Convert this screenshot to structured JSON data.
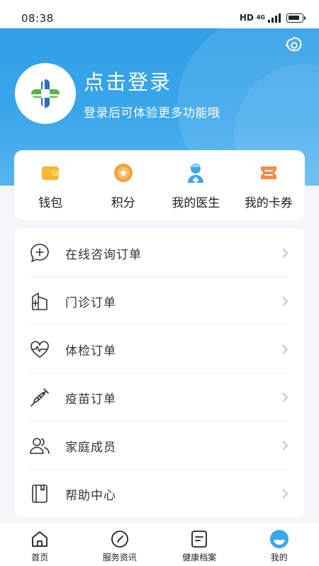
{
  "status_bar": {
    "time": "08:38",
    "hd": "HD",
    "network": "4G"
  },
  "profile": {
    "title": "点击登录",
    "subtitle": "登录后可体验更多功能哦"
  },
  "quick_actions": [
    {
      "label": "钱包",
      "icon": "wallet-icon",
      "color": "#f5b731"
    },
    {
      "label": "积分",
      "icon": "points-star-icon",
      "color": "#f2a03d"
    },
    {
      "label": "我的医生",
      "icon": "doctor-icon",
      "color": "#3ba7ea"
    },
    {
      "label": "我的卡券",
      "icon": "coupon-icon",
      "color": "#f48a4d"
    }
  ],
  "menu": [
    {
      "label": "在线咨询订单",
      "icon": "chat-plus-icon"
    },
    {
      "label": "门诊订单",
      "icon": "hospital-icon"
    },
    {
      "label": "体检订单",
      "icon": "heart-pulse-icon"
    },
    {
      "label": "疫苗订单",
      "icon": "syringe-icon"
    },
    {
      "label": "家庭成员",
      "icon": "family-members-icon"
    },
    {
      "label": "帮助中心",
      "icon": "help-book-icon"
    }
  ],
  "tabbar": [
    {
      "label": "首页",
      "icon": "home-icon"
    },
    {
      "label": "服务资讯",
      "icon": "compass-icon"
    },
    {
      "label": "健康档案",
      "icon": "health-record-icon"
    },
    {
      "label": "我的",
      "icon": "profile-icon",
      "active": true
    }
  ],
  "colors": {
    "header": "#2f9be5",
    "accent": "#3ba7ea",
    "logo_blue": "#2b6fb6",
    "logo_green": "#5bb342"
  }
}
